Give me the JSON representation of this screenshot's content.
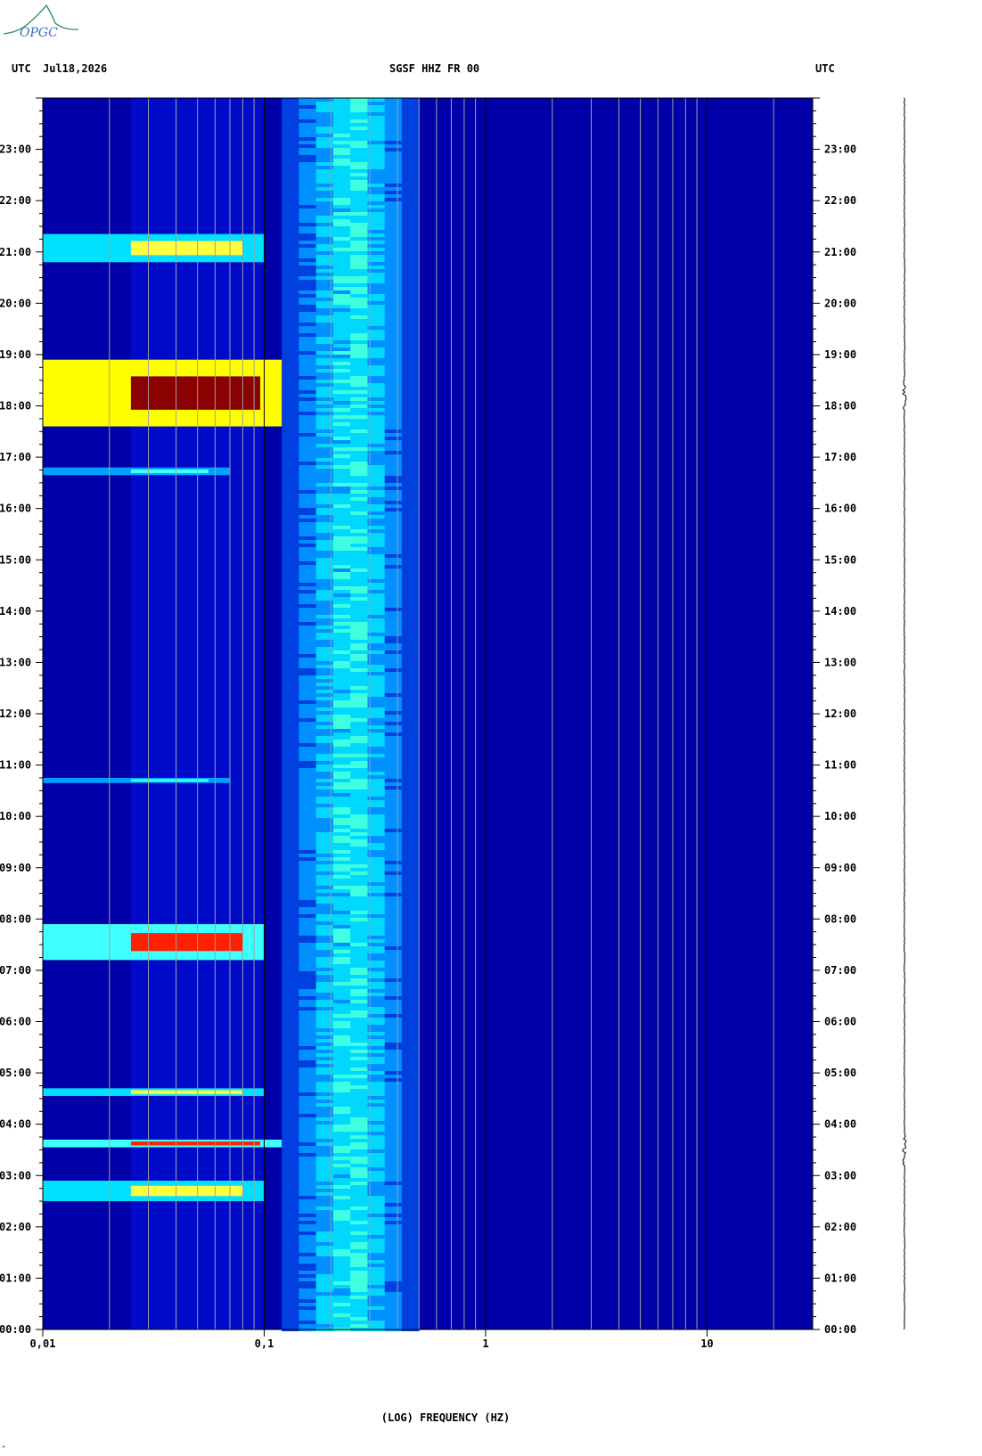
{
  "header": {
    "left_utc": "UTC",
    "date": "Jul18,2026",
    "station": "SGSF HHZ FR 00",
    "right_utc": "UTC"
  },
  "logo": {
    "text": "OPGC",
    "color": "#2e8b57"
  },
  "corner_mark": "^",
  "colors": {
    "background": "#0000a8",
    "low": "#0000c8",
    "mid": "#00ffff",
    "high": "#ffff00",
    "peak": "#8b0000",
    "gridline": "#a0a0a0",
    "decade_line": "#000000"
  },
  "chart_data": {
    "type": "heatmap",
    "title": "SGSF HHZ FR 00",
    "xlabel": "(LOG) FREQUENCY (HZ)",
    "ylabel": "UTC",
    "x_scale": "log",
    "xlim": [
      0.01,
      30
    ],
    "x_tick_labels": [
      "0,01",
      "0,1",
      "1",
      "10"
    ],
    "x_ticks": [
      0.01,
      0.1,
      1,
      10
    ],
    "ylim_hours": [
      0,
      24
    ],
    "y_tick_labels": [
      "00:00",
      "01:00",
      "02:00",
      "03:00",
      "04:00",
      "05:00",
      "06:00",
      "07:00",
      "08:00",
      "09:00",
      "10:00",
      "11:00",
      "12:00",
      "13:00",
      "14:00",
      "15:00",
      "16:00",
      "17:00",
      "18:00",
      "19:00",
      "20:00",
      "21:00",
      "22:00",
      "23:00"
    ],
    "background_band": {
      "f_start": 0.12,
      "f_end": 0.5,
      "level": "cyan"
    },
    "events": [
      {
        "time_start_h": 2.5,
        "time_end_h": 2.9,
        "f_max": 0.1,
        "level": "yellow"
      },
      {
        "time_start_h": 3.55,
        "time_end_h": 3.7,
        "f_max": 0.12,
        "level": "red"
      },
      {
        "time_start_h": 4.55,
        "time_end_h": 4.7,
        "f_max": 0.1,
        "level": "yellow"
      },
      {
        "time_start_h": 7.2,
        "time_end_h": 7.9,
        "f_max": 0.1,
        "level": "red"
      },
      {
        "time_start_h": 10.65,
        "time_end_h": 10.75,
        "f_max": 0.07,
        "level": "cyan"
      },
      {
        "time_start_h": 16.65,
        "time_end_h": 16.8,
        "f_max": 0.07,
        "level": "cyan"
      },
      {
        "time_start_h": 17.6,
        "time_end_h": 18.9,
        "f_max": 0.12,
        "level": "peak"
      },
      {
        "time_start_h": 20.8,
        "time_end_h": 21.35,
        "f_max": 0.1,
        "level": "yellow"
      }
    ],
    "trace_events_h": [
      3.5,
      18.2
    ]
  }
}
